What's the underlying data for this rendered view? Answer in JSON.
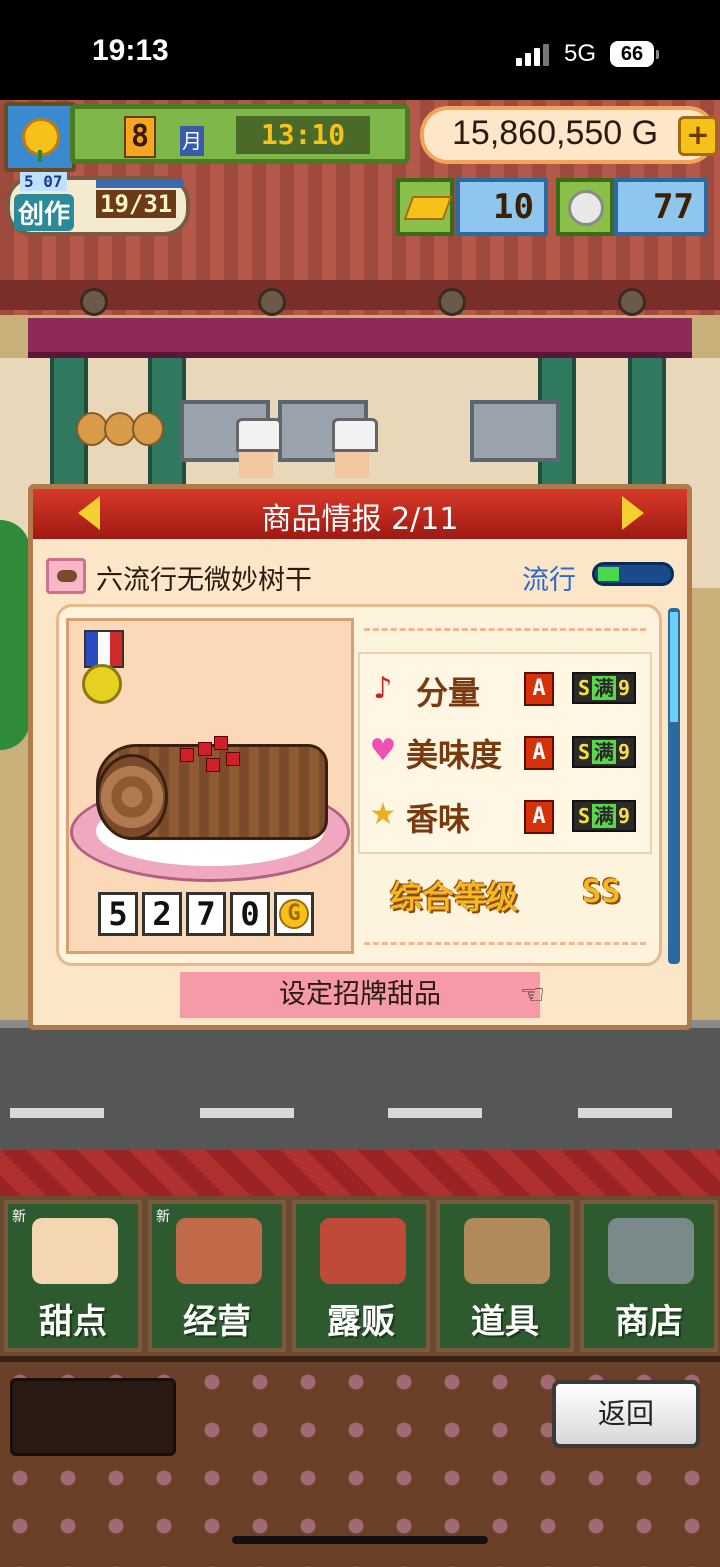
{
  "status_bar": {
    "time": "19:13",
    "network": "5G",
    "battery": "66"
  },
  "hud": {
    "month": "8",
    "month_unit": "月",
    "clock": "13:10",
    "money": "15,860,550 G",
    "money_plus": "+",
    "create_badge": "5 07",
    "create_label": "创作",
    "create_count": "19/31",
    "bars_count": "10",
    "plates_count": "77"
  },
  "dialog": {
    "title": "商品情报 2/11",
    "item_name": "六流行无微妙树干",
    "trend_label": "流行",
    "trend_level": 0.3,
    "price_digits": [
      "5",
      "2",
      "7",
      "0"
    ],
    "price_unit": "G",
    "stats": [
      {
        "icon": "music-note-icon",
        "glyph": "♪",
        "label": "分量",
        "grade": "A",
        "level_pre": "S",
        "level_mid": "满",
        "level_post": "9"
      },
      {
        "icon": "heart-icon",
        "glyph": "♥",
        "label": "美味度",
        "grade": "A",
        "level_pre": "S",
        "level_mid": "满",
        "level_post": "9"
      },
      {
        "icon": "star-icon",
        "glyph": "★",
        "label": "香味",
        "grade": "A",
        "level_pre": "S",
        "level_mid": "满",
        "level_post": "9"
      }
    ],
    "overall_label": "综合等级",
    "overall_grade": "SS",
    "signature_button": "设定招牌甜品"
  },
  "menu": [
    {
      "label": "甜点",
      "new": "新",
      "icon": "cake-icon"
    },
    {
      "label": "经营",
      "new": "新",
      "icon": "shop-icon"
    },
    {
      "label": "露贩",
      "new": "",
      "icon": "food-truck-icon"
    },
    {
      "label": "道具",
      "new": "",
      "icon": "tools-icon"
    },
    {
      "label": "商店",
      "new": "",
      "icon": "shopping-cart-icon"
    }
  ],
  "back_button": "返回",
  "colors": {
    "header_red": "#c0281c",
    "panel_bg": "#fbe6c8",
    "menu_green": "#2e5a30",
    "money_bg": "#fde7c8"
  }
}
